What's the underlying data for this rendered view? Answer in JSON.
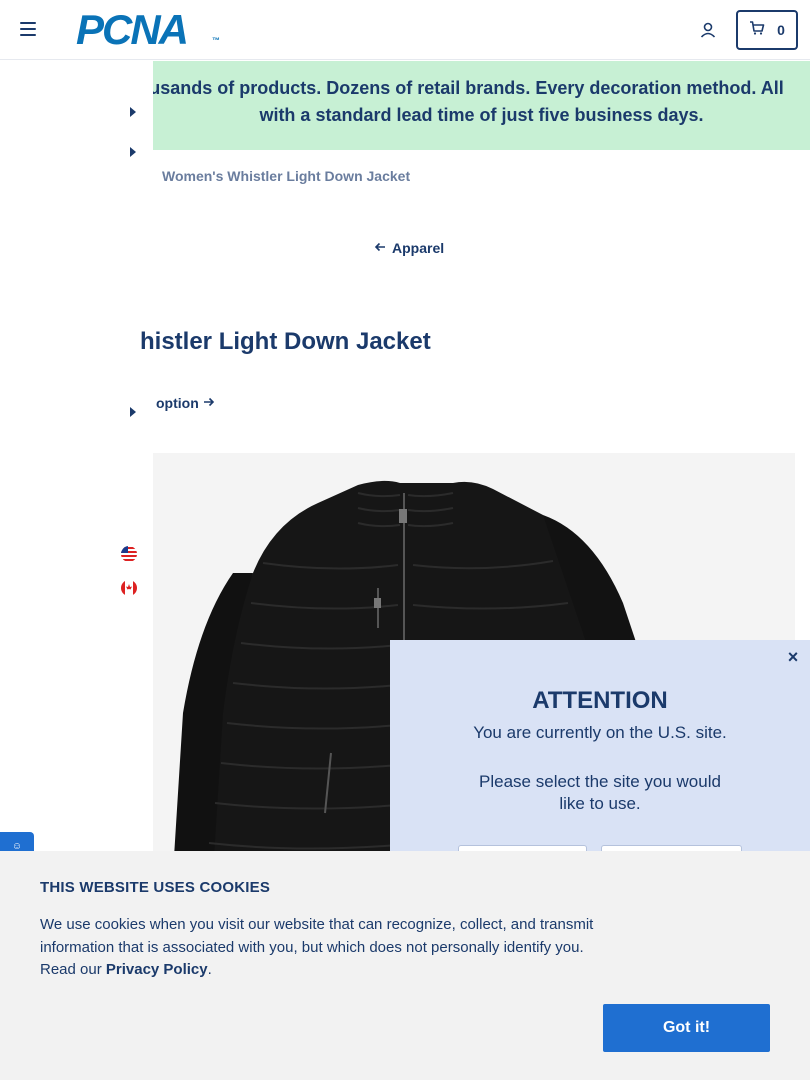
{
  "header": {
    "logo_text": "PCNA",
    "logo_tm": "™",
    "cart_count": "0"
  },
  "promo": {
    "line1": "usands of products. Dozens of retail brands. Every decoration method. All",
    "line2": "with a standard lead time of just five business days."
  },
  "breadcrumb": {
    "current": "Women's Whistler Light Down Jacket"
  },
  "back_link": {
    "label": "Apparel"
  },
  "product": {
    "title": "histler Light Down Jacket",
    "option_link": "option"
  },
  "attention": {
    "title": "ATTENTION",
    "line1": "You are currently on the U.S. site.",
    "line2": "Please select the site you would",
    "line3": "like to use.",
    "close": "×"
  },
  "cookie": {
    "title": "THIS WEBSITE USES COOKIES",
    "text_before": "We use cookies when you visit our website that can recognize, collect, and transmit information that is associated with you, but which does not personally identify you. Read our ",
    "link": "Privacy Policy",
    "text_after": ".",
    "button": "Got it!"
  },
  "chat": {
    "label": "☺"
  },
  "colors": {
    "brand_navy": "#1b3a6b",
    "brand_blue": "#0a73b7",
    "banner_green": "#c7f0d4",
    "modal_blue": "#d9e2f5",
    "button_blue": "#1f6fd1"
  },
  "icons": [
    "hamburger-icon",
    "account-icon",
    "cart-icon",
    "arrow-left-icon",
    "arrow-right-icon",
    "us-flag-icon",
    "canada-flag-icon",
    "close-icon",
    "chat-icon"
  ]
}
